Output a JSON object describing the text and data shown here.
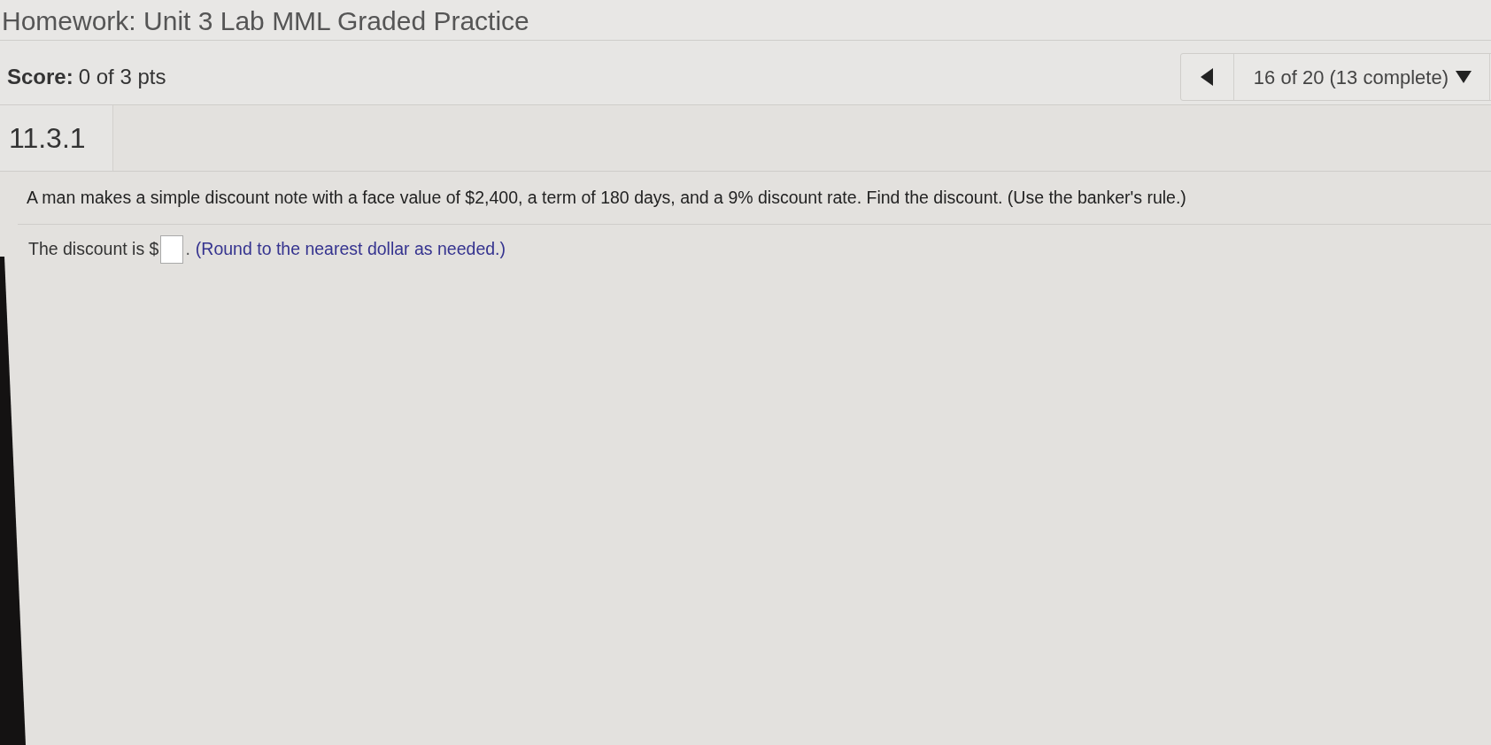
{
  "title": "Homework: Unit 3 Lab MML Graded Practice",
  "score": {
    "label": "Score:",
    "value": "0 of 3 pts"
  },
  "navigator": {
    "position": "16 of 20 (13 complete)"
  },
  "question_number": "11.3.1",
  "question": "A man makes a simple discount note with a face value of $2,400, a term of 180 days, and a 9% discount rate. Find the discount. (Use the banker's rule.)",
  "answer": {
    "prompt": "The discount is $",
    "suffix": ".",
    "hint": "(Round to the nearest dollar as needed.)"
  }
}
